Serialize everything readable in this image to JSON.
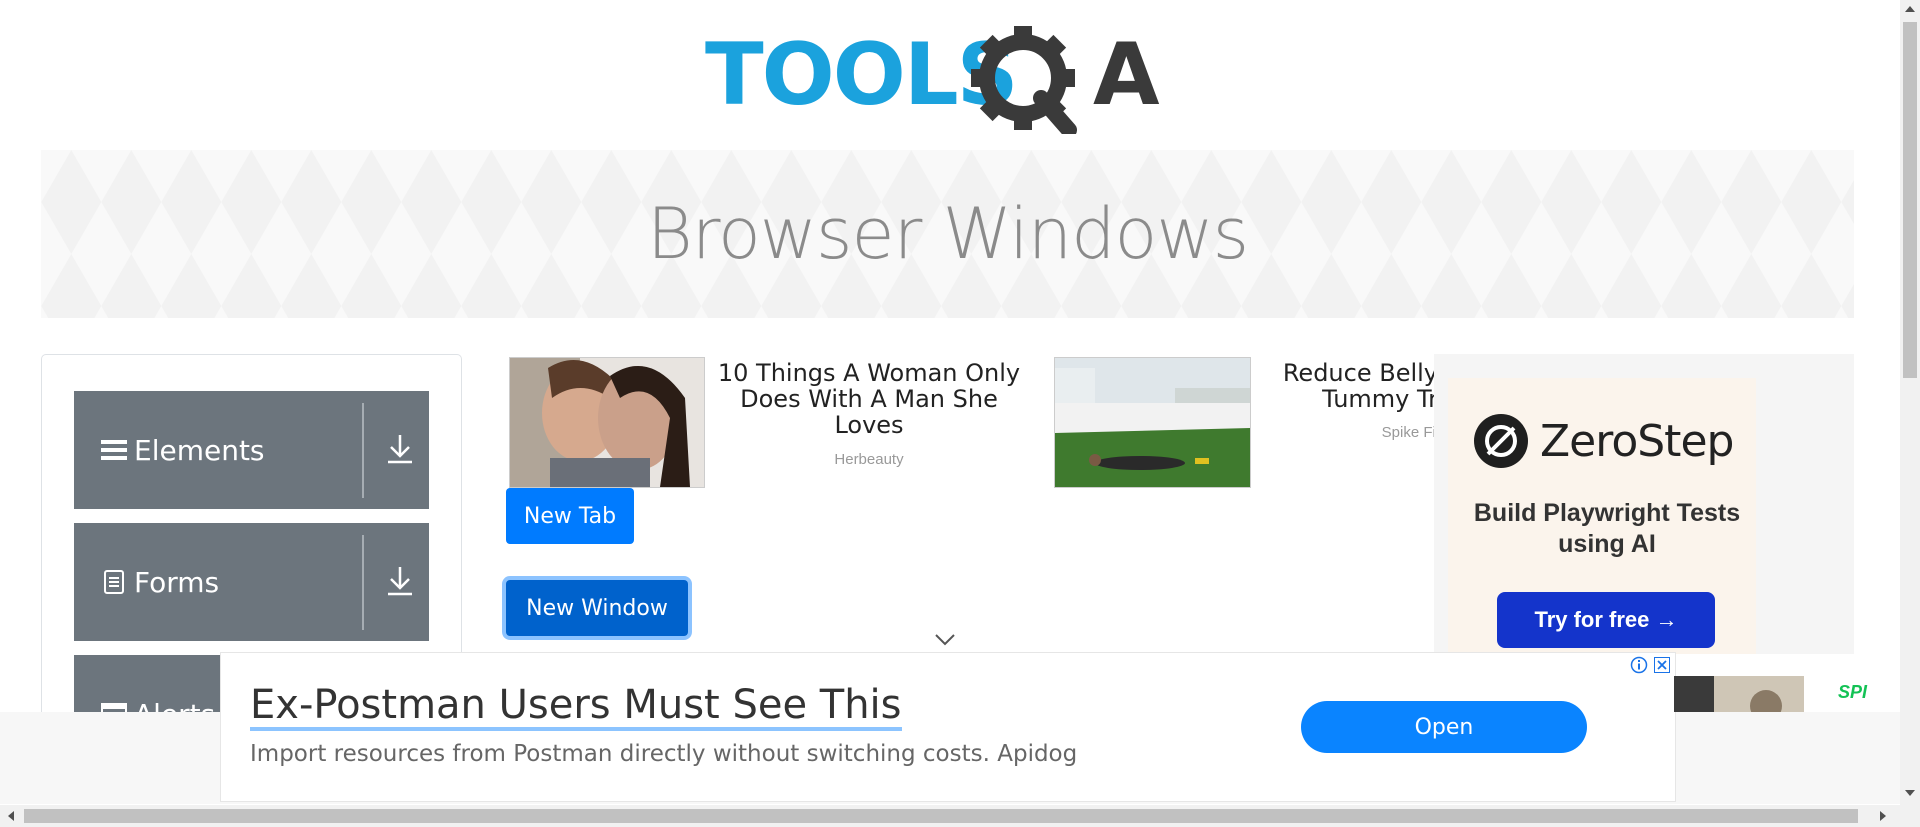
{
  "header": {
    "logo_text_left": "TOOLS",
    "logo_text_right": "A",
    "logo_colors": {
      "blue": "#1ba2dd",
      "dark": "#3a3a3a"
    }
  },
  "banner": {
    "title": "Browser Windows"
  },
  "sidebar": {
    "groups": [
      {
        "label": "Elements",
        "icon": "hamburger-icon"
      },
      {
        "label": "Forms",
        "icon": "document-icon"
      },
      {
        "label": "Alerts",
        "icon": "window-icon"
      }
    ]
  },
  "ads": {
    "card1": {
      "title": "10 Things A Woman Only Does With A Man She Loves",
      "source": "Herbeauty"
    },
    "card2": {
      "title": "Reduce Belly Tummy Tr",
      "source": "Spike Fit"
    }
  },
  "buttons": {
    "new_tab": "New Tab",
    "new_window": "New Window"
  },
  "right_ad": {
    "brand": "ZeroStep",
    "tagline": "Build Playwright Tests using AI",
    "cta": "Try for free →"
  },
  "bottom_ad": {
    "headline": "Ex-Postman Users Must See This",
    "subtext": "Import resources from Postman directly without switching costs. Apidog",
    "cta": "Open",
    "side_text": "SPI"
  },
  "colors": {
    "primary": "#007bff",
    "sidebar_gray": "#6c757d",
    "zerostep_blue": "#1434cb"
  }
}
